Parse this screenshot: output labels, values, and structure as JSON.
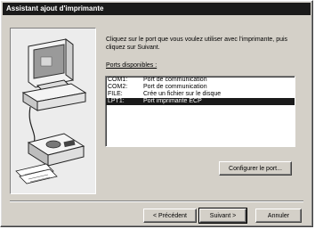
{
  "window": {
    "title": "Assistant ajout d'imprimante"
  },
  "instruction": "Cliquez sur le port que vous voulez utiliser avec l'imprimante, puis cliquez sur Suivant.",
  "ports": {
    "label": "Ports disponibles :",
    "items": [
      {
        "name": "COM1:",
        "description": "Port de communication"
      },
      {
        "name": "COM2:",
        "description": "Port de communication"
      },
      {
        "name": "FILE:",
        "description": "Crée un fichier sur le disque"
      },
      {
        "name": "LPT1:",
        "description": "Port imprimante ECP"
      }
    ],
    "selected_index": 3
  },
  "buttons": {
    "configure": "Configurer le port...",
    "previous": "< Précédent",
    "next": "Suivant >",
    "cancel": "Annuler"
  }
}
